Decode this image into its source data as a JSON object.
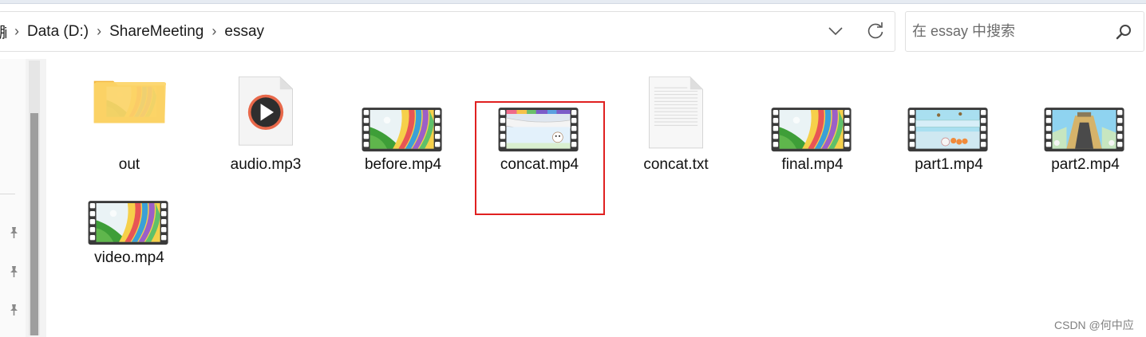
{
  "breadcrumb": {
    "cut_glyph": "脑",
    "items": [
      "Data (D:)",
      "ShareMeeting",
      "essay"
    ],
    "separator": "›"
  },
  "search": {
    "placeholder": "在 essay 中搜索"
  },
  "files": [
    {
      "name": "out",
      "type": "folder"
    },
    {
      "name": "audio.mp3",
      "type": "audio"
    },
    {
      "name": "before.mp4",
      "type": "video",
      "thumb": "rainbow"
    },
    {
      "name": "concat.mp4",
      "type": "video",
      "thumb": "concat",
      "selected": true
    },
    {
      "name": "concat.txt",
      "type": "text"
    },
    {
      "name": "final.mp4",
      "type": "video",
      "thumb": "rainbow"
    },
    {
      "name": "part1.mp4",
      "type": "video",
      "thumb": "part1"
    },
    {
      "name": "part2.mp4",
      "type": "video",
      "thumb": "part2"
    },
    {
      "name": "video.mp4",
      "type": "video",
      "thumb": "rainbow"
    }
  ],
  "watermark": "CSDN @何中应",
  "colors": {
    "highlight": "#e02020",
    "folder": "#f7c548"
  }
}
